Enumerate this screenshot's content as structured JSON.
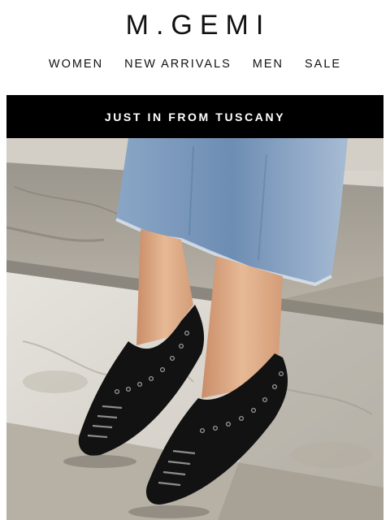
{
  "header": {
    "logo_text": "M.GEMI",
    "nav": [
      {
        "label": "WOMEN"
      },
      {
        "label": "NEW ARRIVALS"
      },
      {
        "label": "MEN"
      },
      {
        "label": "SALE"
      }
    ]
  },
  "banner": {
    "text": "JUST IN FROM TUSCANY"
  },
  "hero": {
    "image_icon": "photo-shoes-on-stone-steps",
    "colors": {
      "banner_bg": "#000000",
      "stone": "#d9d6cf",
      "denim": "#7f9bbd",
      "shoe": "#121212",
      "skin": "#e2b08c"
    }
  }
}
